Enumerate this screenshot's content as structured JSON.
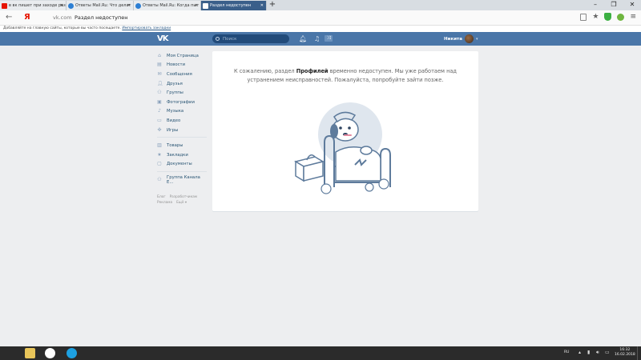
{
  "browser": {
    "tabs": [
      {
        "title": "в вк пишет при заходе раз"
      },
      {
        "title": "Ответы Mail.Ru: Что делат"
      },
      {
        "title": "Ответы Mail.Ru: Когда пыт"
      },
      {
        "title": "Раздел недоступен"
      }
    ],
    "active_tab": 3,
    "new_tab_label": "+",
    "window_controls": {
      "minimize": "–",
      "maximize": "❐",
      "close": "✕"
    },
    "address": {
      "host": "vk.com",
      "title": "Раздел недоступен"
    },
    "notification": {
      "text": "Добавляйте на главную сайты, которые вы часто посещаете.",
      "link": "Импортировать закладки"
    }
  },
  "header": {
    "logo": "VK",
    "search": {
      "placeholder": "Поиск"
    },
    "user_name": "Никита"
  },
  "sidebar": {
    "items": [
      {
        "label": "Моя Страница",
        "icon": "home-icon"
      },
      {
        "label": "Новости",
        "icon": "news-icon"
      },
      {
        "label": "Сообщения",
        "icon": "messages-icon"
      },
      {
        "label": "Друзья",
        "icon": "friends-icon"
      },
      {
        "label": "Группы",
        "icon": "groups-icon"
      },
      {
        "label": "Фотографии",
        "icon": "photo-icon"
      },
      {
        "label": "Музыка",
        "icon": "music-icon"
      },
      {
        "label": "Видео",
        "icon": "video-icon"
      },
      {
        "label": "Игры",
        "icon": "games-icon"
      }
    ],
    "items2": [
      {
        "label": "Товары",
        "icon": "goods-icon"
      },
      {
        "label": "Закладки",
        "icon": "bookmarks-icon"
      },
      {
        "label": "Документы",
        "icon": "documents-icon"
      }
    ],
    "items3": [
      {
        "label": "Группа Канала Е...",
        "icon": "group-icon"
      }
    ],
    "footer": [
      "Блог",
      "Разработчикам",
      "Реклама",
      "Ещё ▾"
    ]
  },
  "main": {
    "message_before": "К сожалению, раздел ",
    "message_bold": "Профилей",
    "message_after": " временно недоступен. Мы уже работаем над устранением неисправностей. Пожалуйста, попробуйте зайти позже."
  },
  "taskbar": {
    "lang": "RU",
    "time": "16:32",
    "date": "16.02.2018"
  },
  "colors": {
    "vk_blue": "#4a76a8",
    "page_bg": "#edeef0",
    "link": "#285473"
  }
}
